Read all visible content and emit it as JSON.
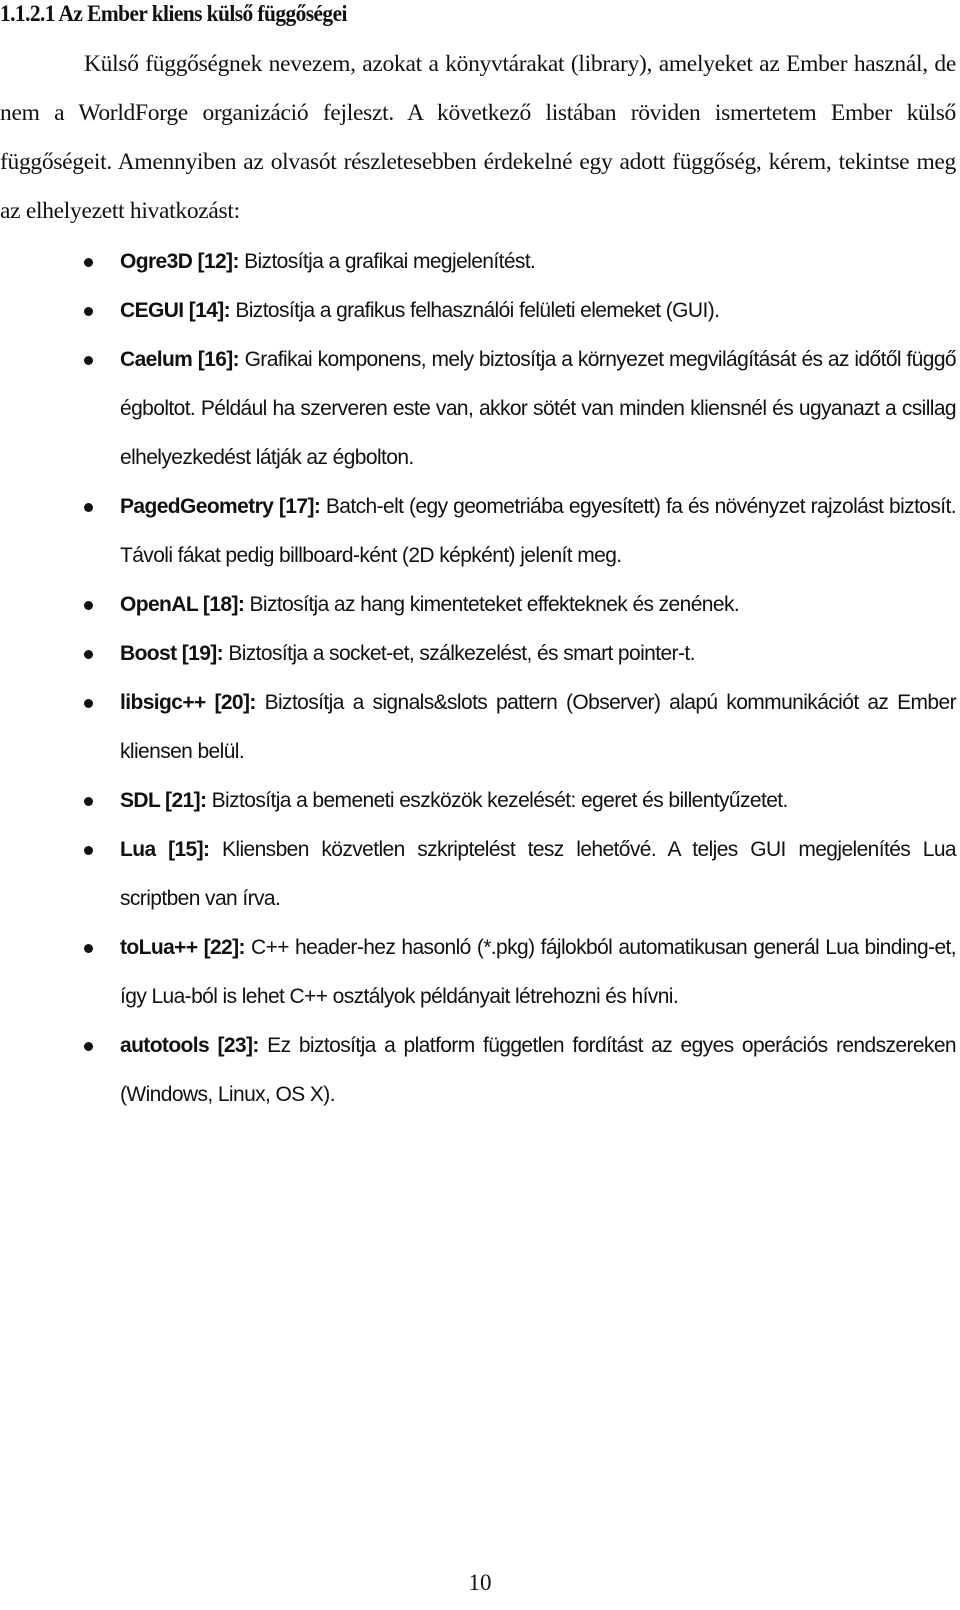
{
  "heading": "1.1.2.1 Az Ember kliens külső függőségei",
  "intro": "Külső függőségnek nevezem, azokat a könyvtárakat (library), amelyeket az Ember használ, de nem a WorldForge organizáció fejleszt. A következő listában röviden ismertetem Ember külső függőségeit. Amennyiben az olvasót részletesebben érdekelné egy adott függőség, kérem, tekintse meg az elhelyezett hivatkozást:",
  "dependencies": [
    {
      "name": "Ogre3D [12]:",
      "description": " Biztosítja a grafikai megjelenítést."
    },
    {
      "name": "CEGUI [14]:",
      "description": " Biztosítja a grafikus felhasználói felületi elemeket (GUI)."
    },
    {
      "name": "Caelum [16]:",
      "description": " Grafikai komponens, mely biztosítja a környezet megvilágítását és az időtől függő égboltot. Például ha szerveren este van, akkor sötét van minden kliensnél és ugyanazt a csillag elhelyezkedést látják az égbolton."
    },
    {
      "name": "PagedGeometry [17]:",
      "description": " Batch-elt (egy geometriába egyesített) fa és növényzet rajzolást biztosít. Távoli fákat pedig billboard-ként (2D képként) jelenít meg."
    },
    {
      "name": "OpenAL [18]:",
      "description": " Biztosítja az hang kimenteteket effekteknek és zenének."
    },
    {
      "name": "Boost [19]:",
      "description": " Biztosítja a socket-et, szálkezelést, és smart pointer-t."
    },
    {
      "name": "libsigc++ [20]:",
      "description": " Biztosítja a signals&slots pattern (Observer) alapú kommunikációt az Ember kliensen belül."
    },
    {
      "name": "SDL [21]:",
      "description": " Biztosítja a bemeneti eszközök kezelését: egeret és billentyűzetet."
    },
    {
      "name": "Lua [15]:",
      "description": " Kliensben közvetlen szkriptelést tesz lehetővé. A teljes GUI megjelenítés Lua scriptben van írva."
    },
    {
      "name": "toLua++ [22]:",
      "description": " C++ header-hez hasonló (*.pkg) fájlokból automatikusan generál Lua binding-et, így Lua-ból is lehet C++ osztályok példányait létrehozni és hívni."
    },
    {
      "name": "autotools [23]:",
      "description": " Ez biztosítja a platform független fordítást az egyes operációs rendszereken (Windows, Linux, OS X)."
    }
  ],
  "page_number": "10"
}
